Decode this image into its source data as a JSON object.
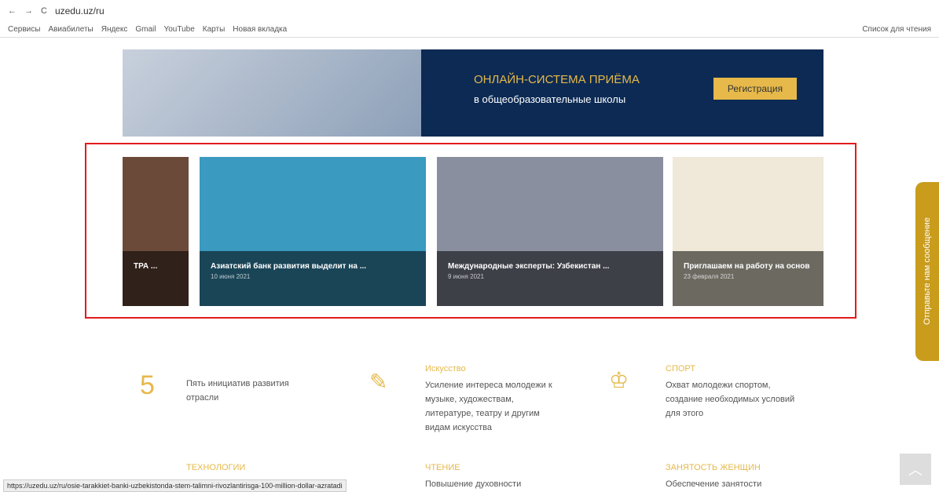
{
  "url": "uzedu.uz/ru",
  "bookmarks": [
    "Сервисы",
    "Авиабилеты",
    "Яндекс",
    "Gmail",
    "YouTube",
    "Карты",
    "Новая вкладка"
  ],
  "reading_list": "Список для чтения",
  "hero": {
    "title": "ОНЛАЙН-СИСТЕМА ПРИЁМА",
    "sub": "в общеобразовательные школы",
    "button": "Регистрация"
  },
  "cards": [
    {
      "title": "ТРА ...",
      "date": ""
    },
    {
      "title": "Азиатский банк развития выделит на ...",
      "date": "10 июня 2021"
    },
    {
      "title": "Международные эксперты: Узбекистан ...",
      "date": "9 июня 2021"
    },
    {
      "title": "Приглашаем на работу на основ",
      "date": "23 февраля 2021"
    }
  ],
  "items": [
    {
      "num": "5",
      "text": "Пять инициатив развития отрасли"
    },
    {
      "title": "Искусство",
      "text": "Усиление интереса молодежи к музыке, художествам, литературе, театру и другим видам искусства"
    },
    {
      "title": "СПОРТ",
      "text": "Охват молодежи спортом, создание необходимых условий для этого"
    },
    {
      "title": "ТЕХНОЛОГИИ"
    },
    {
      "title": "ЧТЕНИЕ",
      "text": "Повышение духовности"
    },
    {
      "title": "ЗАНЯТОСТЬ ЖЕНЩИН",
      "text": "Обеспечение занятости"
    }
  ],
  "side": "Отправьте нам сообщение",
  "status": "https://uzedu.uz/ru/osie-tarakkiet-banki-uzbekistonda-stem-talimni-rivozlantirisga-100-million-dollar-azratadi"
}
